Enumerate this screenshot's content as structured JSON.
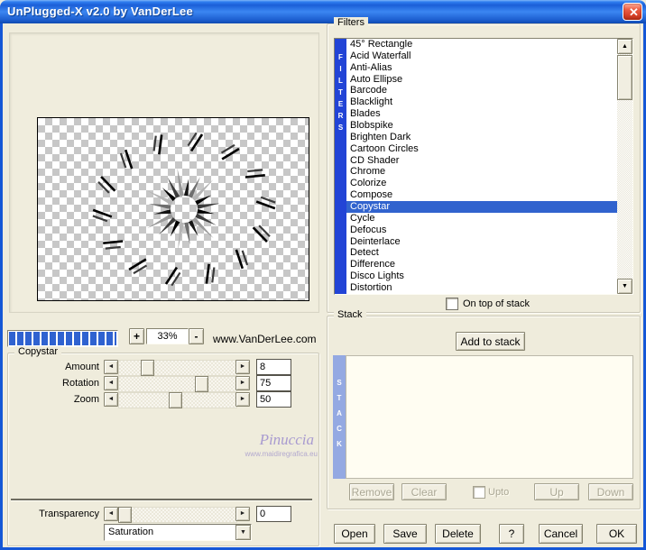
{
  "window": {
    "title": "UnPlugged-X v2.0 by VanDerLee"
  },
  "icons": {
    "close": "✕",
    "left_arrow": "◄",
    "right_arrow": "►",
    "up_arrow": "▲",
    "down_arrow": "▼"
  },
  "colors": {
    "selection": "#3163ce",
    "filters_strip": "#2244d6",
    "stack_strip": "#94a9e2",
    "title_blue": "#1b5fd7",
    "progress_blue": "#2f62d0"
  },
  "filters": {
    "label": "Filters",
    "strip_text": "FILTERS",
    "items": [
      "45° Rectangle",
      "Acid Waterfall",
      "Anti-Alias",
      "Auto Ellipse",
      "Barcode",
      "Blacklight",
      "Blades",
      "Blobspike",
      "Brighten Dark",
      "Cartoon Circles",
      "CD Shader",
      "Chrome",
      "Colorize",
      "Compose",
      "Copystar",
      "Cycle",
      "Defocus",
      "Deinterlace",
      "Detect",
      "Difference",
      "Disco Lights",
      "Distortion"
    ],
    "selected_index": 14,
    "selected_item": "Copystar",
    "on_top_checkbox": {
      "label": "On top of stack",
      "checked": false
    }
  },
  "preview": {
    "zoom_in_label": "+",
    "zoom_value": "33%",
    "zoom_out_label": "-",
    "website": "www.VanDerLee.com"
  },
  "copystar": {
    "label": "Copystar",
    "sliders": [
      {
        "label": "Amount",
        "value": "8",
        "fraction": 0.21
      },
      {
        "label": "Rotation",
        "value": "75",
        "fraction": 0.73
      },
      {
        "label": "Zoom",
        "value": "50",
        "fraction": 0.48
      }
    ],
    "transparency": {
      "label": "Transparency",
      "value": "0",
      "fraction": 0
    },
    "blend_mode": "Saturation",
    "watermark": {
      "name": "Pinuccia",
      "url": "www.maidiregrafica.eu"
    }
  },
  "stack": {
    "label": "Stack",
    "strip_text": "STACK",
    "add_button": "Add to stack",
    "remove_button": "Remove",
    "clear_button": "Clear",
    "upto_checkbox": {
      "label": "Upto",
      "checked": false,
      "disabled": true
    },
    "up_button": "Up",
    "down_button": "Down",
    "items": []
  },
  "footer": {
    "buttons": [
      "Open",
      "Save",
      "Delete",
      "?",
      "Cancel",
      "OK"
    ]
  }
}
